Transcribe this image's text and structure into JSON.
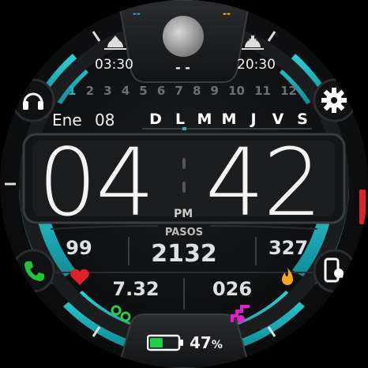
{
  "sun": {
    "sunrise": "03:30",
    "sunset": "20:30"
  },
  "moon": {
    "left_dash": "--",
    "right_dash": "--",
    "bottom_dash": "- -"
  },
  "months": [
    "1",
    "2",
    "3",
    "4",
    "5",
    "6",
    "7",
    "8",
    "9",
    "10",
    "11",
    "12"
  ],
  "active_month": "1",
  "date": {
    "month": "Ene",
    "day": "08"
  },
  "weekdays": [
    "D",
    "L",
    "M",
    "M",
    "J",
    "V",
    "S"
  ],
  "active_weekday_index": 1,
  "time": {
    "hours": "04",
    "minutes": "42",
    "ampm": "PM"
  },
  "steps": {
    "label": "PASOS",
    "value": "2132"
  },
  "heart_rate": "99",
  "calories": "327",
  "distance": "7.32",
  "floors": "026",
  "battery": {
    "percent": "47",
    "unit": "%",
    "level": 0.47
  },
  "colors": {
    "accent": "#1fb8c4",
    "heart": "#e0202a",
    "fire": "#f5a623",
    "phone": "#22c43a",
    "location": "#2ecc40",
    "floors": "#e020c8",
    "battery": "#1fd04a"
  },
  "icons": {
    "headphones": "headphones-icon",
    "settings": "gear-icon",
    "phone": "phone-icon",
    "phone_find": "phone-find-icon"
  }
}
